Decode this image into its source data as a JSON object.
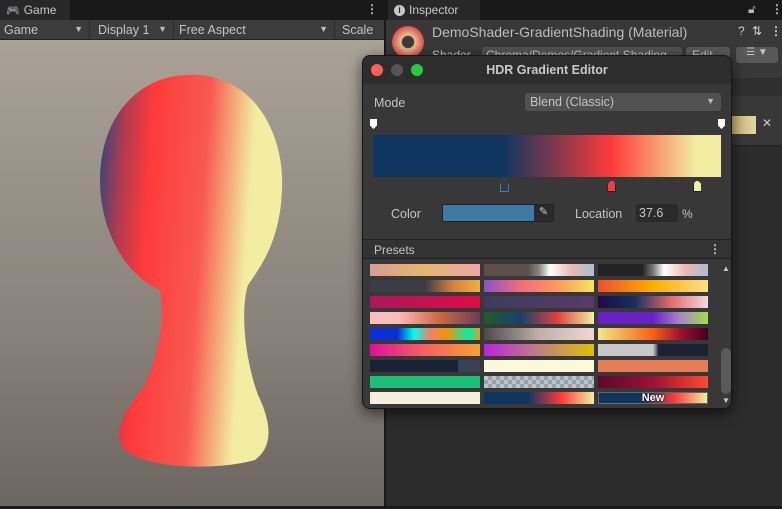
{
  "game_tab": {
    "label": "Game",
    "icon": "gamepad-icon"
  },
  "game_toolbar": {
    "view": "Game",
    "display": "Display 1",
    "aspect": "Free Aspect",
    "scale": "Scale"
  },
  "inspector_tab": {
    "label": "Inspector",
    "icon": "info-icon"
  },
  "inspector": {
    "material_name": "DemoShader-GradientShading (Material)",
    "shader_label": "Shader",
    "shader_value": "Chroma/Demos/Gradient Shading",
    "edit_label": "Edit..."
  },
  "editor": {
    "title": "HDR Gradient Editor",
    "mode_label": "Mode",
    "mode_value": "Blend (Classic)",
    "color_label": "Color",
    "color_value": "#3d7ba6",
    "location_label": "Location",
    "location_value": "37.6",
    "location_unit": "%",
    "gradient_keys": [
      {
        "color": "#10365f",
        "location": 0
      },
      {
        "color": "#10365f",
        "location": 37.6
      },
      {
        "color": "#fe3a3a",
        "location": 68.5
      },
      {
        "color": "#f2eda0",
        "location": 93
      }
    ],
    "presets_label": "Presets",
    "new_label": "New",
    "presets": [
      "linear-gradient(90deg,#d99c92,#e3b76e,#f4a4a4)",
      "linear-gradient(90deg,#5c504d 40%,#8a8480,#fff 60%,#e9b7b1,#a9bfcf)",
      "linear-gradient(90deg,#232323 40%,#777,#fff 60%,#eab8ae,#a9bfcf)",
      "linear-gradient(90deg,#3a3d45 50%,#d58040,#f0b03c)",
      "linear-gradient(90deg,#8854c8,#f46b7a,#fa9a5c,#f6e55c)",
      "linear-gradient(90deg,#ee4f2c,#ffad00,#fddf86)",
      "linear-gradient(90deg,#a8185c,#e20a44)",
      "linear-gradient(90deg,#3b3c5e,#593a68)",
      "linear-gradient(90deg,#22084a,#182e62,#e46c6c,#f0dcdc)",
      "linear-gradient(90deg,#fdbcbc 25%,#cf6a40,#6c3b58)",
      "linear-gradient(90deg,#235a2e,#16426a,#e04040,#f0f0a0)",
      "linear-gradient(90deg,#6a20c8 50%,#a888c8,#a0e040)",
      "linear-gradient(90deg,#0a2fd8 25%,#00ffe8 40%,#f48060,#f29010 70%,#00f0a0 90%,#d8a030)",
      "linear-gradient(90deg,#4a4a4a,#c0b0a8,#f0d8d0)",
      "linear-gradient(90deg,#f4e888,#fa6010 50%,#a01030,#400020)",
      "linear-gradient(90deg,#e0109c,#f86060,#f8a030)",
      "linear-gradient(90deg,#c020e0,#c08080,#e0c000)",
      "linear-gradient(90deg,#c8c8c8 50%,#6a6e80 53%,#1c2234 55%)",
      "linear-gradient(90deg,#1a2236 80%,#374257 80%)",
      "linear-gradient(90deg,#fcf9d9,#fcf9d9)",
      "linear-gradient(90deg,#e87c54,#e87c54)",
      "linear-gradient(90deg,#1ac077,#1ac077)",
      "repeating-conic-gradient(#9aa0a8 0 25%,#bac4cc 0 50%) 0 0/8px 8px",
      "linear-gradient(90deg,#5a0a2c,#a01030,#ff4a30)",
      "linear-gradient(90deg,#f6eedc,#f6eedc)",
      "linear-gradient(90deg,#10365f 40%,#fe3a3a 70%,#f2eda0)"
    ]
  }
}
